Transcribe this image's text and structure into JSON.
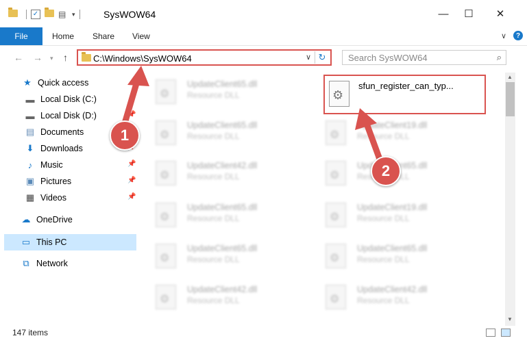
{
  "window": {
    "title": "SysWOW64",
    "controls": {
      "minimize": "—",
      "maximize": "☐",
      "close": "✕"
    }
  },
  "ribbon": {
    "tabs": [
      {
        "label": "File"
      },
      {
        "label": "Home"
      },
      {
        "label": "Share"
      },
      {
        "label": "View"
      }
    ],
    "expand_glyph": "∨",
    "help_glyph": "?"
  },
  "address": {
    "path": "C:\\Windows\\SysWOW64",
    "refresh_glyph": "↻"
  },
  "search": {
    "placeholder": "Search SysWOW64"
  },
  "nav": {
    "items": [
      {
        "label": "Quick access",
        "icon": "star-icon"
      },
      {
        "label": "Local Disk (C:)",
        "icon": "drive-icon"
      },
      {
        "label": "Local Disk (D:)",
        "icon": "drive-icon"
      },
      {
        "label": "Documents",
        "icon": "documents-icon"
      },
      {
        "label": "Downloads",
        "icon": "download-icon"
      },
      {
        "label": "Music",
        "icon": "music-icon"
      },
      {
        "label": "Pictures",
        "icon": "pictures-icon"
      },
      {
        "label": "Videos",
        "icon": "videos-icon"
      },
      {
        "label": "OneDrive",
        "icon": "cloud-icon"
      },
      {
        "label": "This PC",
        "icon": "monitor-icon",
        "selected": true
      },
      {
        "label": "Network",
        "icon": "network-icon"
      }
    ]
  },
  "files": {
    "left": [
      {
        "name": "UpdateClient65.dll",
        "type": "Resource DLL"
      },
      {
        "name": "UpdateClient65.dll",
        "type": "Resource DLL"
      },
      {
        "name": "UpdateClient42.dll",
        "type": "Resource DLL"
      },
      {
        "name": "UpdateClient65.dll",
        "type": "Resource DLL"
      },
      {
        "name": "UpdateClient65.dll",
        "type": "Resource DLL"
      },
      {
        "name": "UpdateClient42.dll",
        "type": "Resource DLL"
      }
    ],
    "right": [
      {
        "name": "UpdateClient19.dll",
        "type": "Resource DLL"
      },
      {
        "name": "UpdateClient65.dll",
        "type": "Resource DLL"
      },
      {
        "name": "UpdateClient19.dll",
        "type": "Resource DLL"
      },
      {
        "name": "UpdateClient65.dll",
        "type": "Resource DLL"
      },
      {
        "name": "UpdateClient42.dll",
        "type": "Resource DLL"
      }
    ],
    "highlighted": {
      "name": "sfun_register_can_typ..."
    }
  },
  "status": {
    "item_count": "147 items"
  },
  "annotations": {
    "badge1": "1",
    "badge2": "2"
  },
  "colors": {
    "accent": "#1979ca",
    "highlight": "#d9534f",
    "selection": "#cce8ff"
  }
}
